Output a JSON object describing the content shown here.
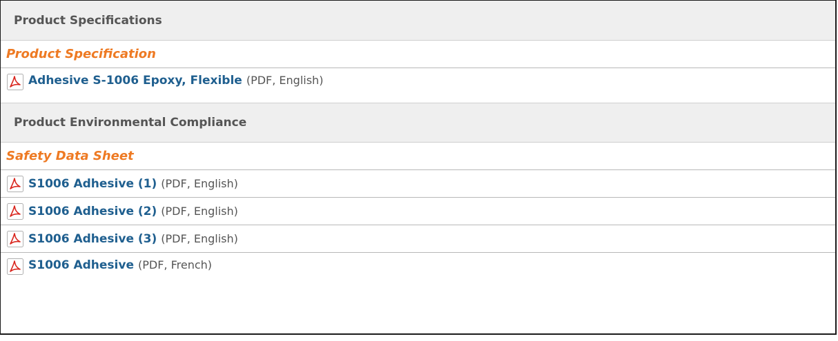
{
  "sections": [
    {
      "header": "Product Specifications",
      "category": "Product Specification",
      "documents": [
        {
          "title": "Adhesive S-1006 Epoxy, Flexible",
          "meta": "(PDF, English)",
          "icon": "pdf-icon"
        }
      ]
    },
    {
      "header": "Product Environmental Compliance",
      "category": "Safety Data Sheet",
      "documents": [
        {
          "title": "S1006 Adhesive (1)",
          "meta": "(PDF, English)",
          "icon": "pdf-icon"
        },
        {
          "title": "S1006 Adhesive (2)",
          "meta": "(PDF, English)",
          "icon": "pdf-icon"
        },
        {
          "title": "S1006 Adhesive (3)",
          "meta": "(PDF, English)",
          "icon": "pdf-icon"
        },
        {
          "title": "S1006 Adhesive",
          "meta": "(PDF, French)",
          "icon": "pdf-icon"
        }
      ]
    }
  ],
  "colors": {
    "header_bg": "#efefef",
    "category_text": "#ee7a23",
    "link_text": "#1f5f8f",
    "pdf_icon_red": "#d9251d"
  }
}
